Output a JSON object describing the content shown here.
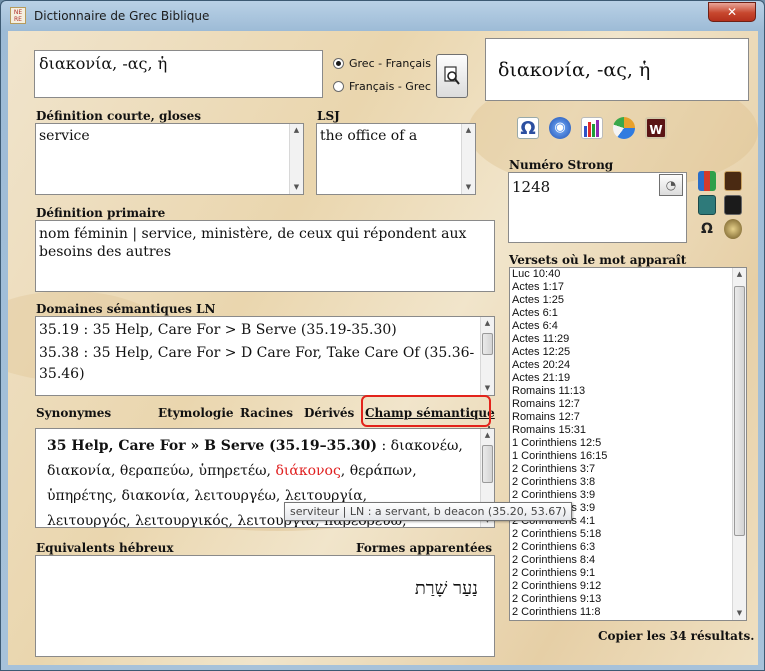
{
  "window": {
    "title": "Dictionnaire de Grec Biblique",
    "icon_text": "NE\nRE",
    "close_label": "✕"
  },
  "search": {
    "value": "διακονία, -ας, ἡ",
    "options": [
      "Grec - Français",
      "Français - Grec"
    ],
    "selected": "Grec - Français"
  },
  "headword": "διακονία, -ας, ἡ",
  "short_def": {
    "label": "Définition courte, gloses",
    "value": "service"
  },
  "lsj": {
    "label": "LSJ",
    "value": "the office of a"
  },
  "strong": {
    "label": "Numéro Strong",
    "value": "1248"
  },
  "primary_def": {
    "label": "Définition primaire",
    "value": "nom féminin | service, ministère, de ceux qui répondent aux besoins des autres"
  },
  "ln_domains": {
    "label": "Domaines sémantiques LN",
    "line1": "35.19 : 35 Help, Care For > B Serve (35.19-35.30)",
    "line2": "35.38 : 35 Help, Care For > D Care For, Take Care Of (35.36-35.46)"
  },
  "tabs": {
    "synonymes": "Synonymes",
    "etymologie": "Etymologie",
    "racines": "Racines",
    "derives": "Dérivés",
    "champ": "Champ sémantique"
  },
  "champ_content": {
    "heading": "35 Help, Care For » B Serve (35.19–35.30)",
    "line1_rest": " : διακονέω,",
    "line2_pre": "διακονία, θεραπεύω, ὑπηρετέω, ",
    "line2_red": "διάκονος",
    "line2_post": ", θεράπων,",
    "line3": "ὑπηρέτης, διακονία, λειτουργέω, λειτουργία,",
    "line4": "λειτουργός, λειτουργικός, λειτουργία, παρεδρεύω,"
  },
  "tooltip": "serviteur | LN : a servant, b deacon (35.20, 53.67)",
  "hebrew": {
    "label": "Equivalents hébreux",
    "related_label": "Formes apparentées",
    "value": "נַעַר שָׁרַת"
  },
  "verses": {
    "label": "Versets où le mot apparaît",
    "items": [
      "Luc 10:40",
      "Actes 1:17",
      "Actes 1:25",
      "Actes 6:1",
      "Actes 6:4",
      "Actes 11:29",
      "Actes 12:25",
      "Actes 20:24",
      "Actes 21:19",
      "Romains 11:13",
      "Romains 12:7",
      "Romains 12:7",
      "Romains 15:31",
      "1 Corinthiens 12:5",
      "1 Corinthiens 16:15",
      "2 Corinthiens 3:7",
      "2 Corinthiens 3:8",
      "2 Corinthiens 3:9",
      "2 Corinthiens 3:9",
      "2 Corinthiens 4:1",
      "2 Corinthiens 5:18",
      "2 Corinthiens 6:3",
      "2 Corinthiens 8:4",
      "2 Corinthiens 9:1",
      "2 Corinthiens 9:12",
      "2 Corinthiens 9:13",
      "2 Corinthiens 11:8"
    ],
    "copy_label": "Copier les 34 résultats."
  },
  "icons": [
    "omega-icon",
    "globe-search-icon",
    "bar-chart-icon",
    "pie-chart-icon",
    "w-logo-icon",
    "books-icon",
    "book-icon",
    "scroll-icon",
    "dark-book-icon",
    "omega-small-icon",
    "mask-icon",
    "speaker-icon",
    "search-doc-icon"
  ]
}
